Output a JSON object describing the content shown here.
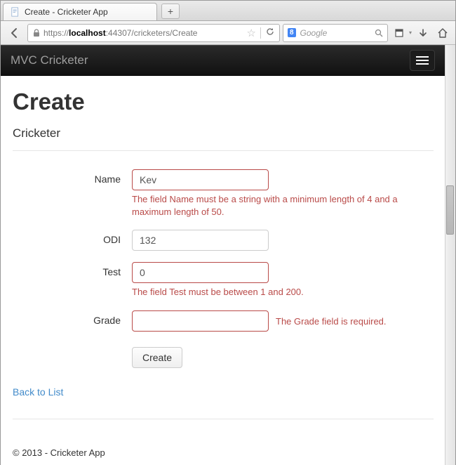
{
  "browser": {
    "tab_title": "Create - Cricketer App",
    "new_tab_symbol": "+",
    "url_scheme": "https://",
    "url_host": "localhost",
    "url_port": ":44307",
    "url_path": "/cricketers/Create",
    "search_provider": "8",
    "search_placeholder": "Google"
  },
  "navbar": {
    "brand": "MVC Cricketer"
  },
  "page": {
    "heading": "Create",
    "subheading": "Cricketer",
    "fields": {
      "name": {
        "label": "Name",
        "value": "Kev",
        "error": "The field Name must be a string with a minimum length of 4 and a maximum length of 50."
      },
      "odi": {
        "label": "ODI",
        "value": "132",
        "error": ""
      },
      "test": {
        "label": "Test",
        "value": "0",
        "error": "The field Test must be between 1 and 200."
      },
      "grade": {
        "label": "Grade",
        "value": "",
        "error": "The Grade field is required."
      }
    },
    "submit_label": "Create",
    "back_link": "Back to List",
    "footer": "© 2013 - Cricketer App"
  }
}
